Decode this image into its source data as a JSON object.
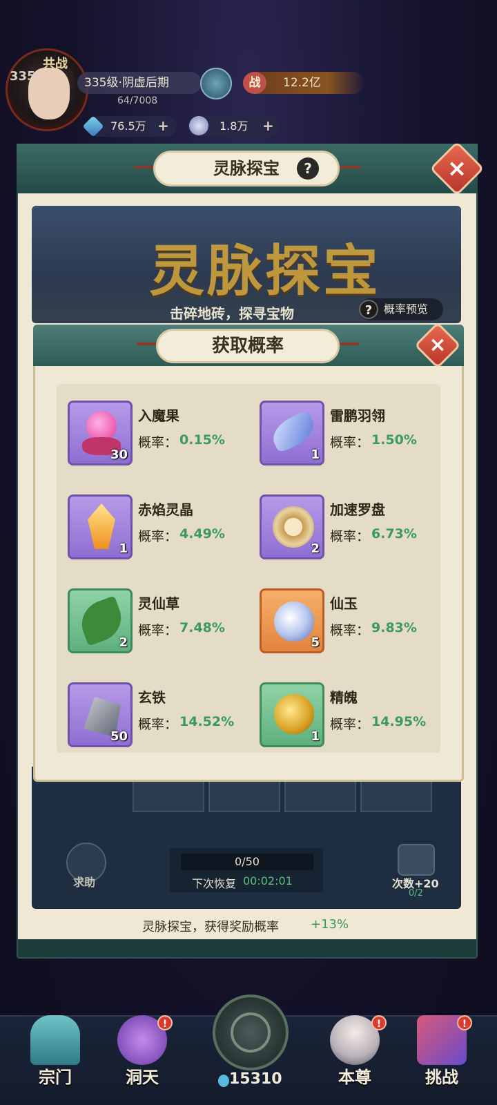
{
  "top_bar": {
    "level": "335",
    "title_tag": "共战",
    "realm": "335级·阴虚后期",
    "exp": "64/7008",
    "power_icon": "战",
    "power": "12.2亿",
    "currency1": "76.5万",
    "currency2": "1.8万"
  },
  "main": {
    "header_title": "灵脉探宝",
    "banner_title": "灵脉探宝",
    "banner_subtitle": "击碎地砖，探寻宝物",
    "preview_label": "概率预览",
    "counter": "0/50",
    "recover_label": "下次恢复",
    "recover_time": "00:02:01",
    "help_label": "求助",
    "count_label": "次数+20",
    "count_sub": "0/2",
    "bottom_note": "灵脉探宝，获得奖励概率",
    "bottom_note_hi": "+13%"
  },
  "modal": {
    "title": "获取概率",
    "rate_label": "概率：",
    "items": [
      {
        "name": "入魔果",
        "rate": "0.15%",
        "count": "30",
        "rarity": "purple",
        "icon": "pink-fruit-icon"
      },
      {
        "name": "雷鹏羽翎",
        "rate": "1.50%",
        "count": "1",
        "rarity": "purple",
        "icon": "feather-icon"
      },
      {
        "name": "赤焰灵晶",
        "rate": "4.49%",
        "count": "1",
        "rarity": "purple",
        "icon": "crystal-icon"
      },
      {
        "name": "加速罗盘",
        "rate": "6.73%",
        "count": "2",
        "rarity": "purple",
        "icon": "compass-icon"
      },
      {
        "name": "灵仙草",
        "rate": "7.48%",
        "count": "2",
        "rarity": "green",
        "icon": "herb-icon"
      },
      {
        "name": "仙玉",
        "rate": "9.83%",
        "count": "5",
        "rarity": "orange",
        "icon": "jade-icon"
      },
      {
        "name": "玄铁",
        "rate": "14.52%",
        "count": "50",
        "rarity": "purple",
        "icon": "iron-ore-icon"
      },
      {
        "name": "精魄",
        "rate": "14.95%",
        "count": "1",
        "rarity": "green",
        "icon": "spirit-orb-icon"
      }
    ]
  },
  "nav": {
    "items": [
      {
        "label": "宗门",
        "icon": "sect-gate-icon"
      },
      {
        "label": "洞天",
        "icon": "grotto-tree-icon"
      },
      {
        "label": "本尊",
        "icon": "character-icon"
      },
      {
        "label": "挑战",
        "icon": "challenge-icon"
      }
    ],
    "center_count": "15310",
    "badge": "!"
  }
}
